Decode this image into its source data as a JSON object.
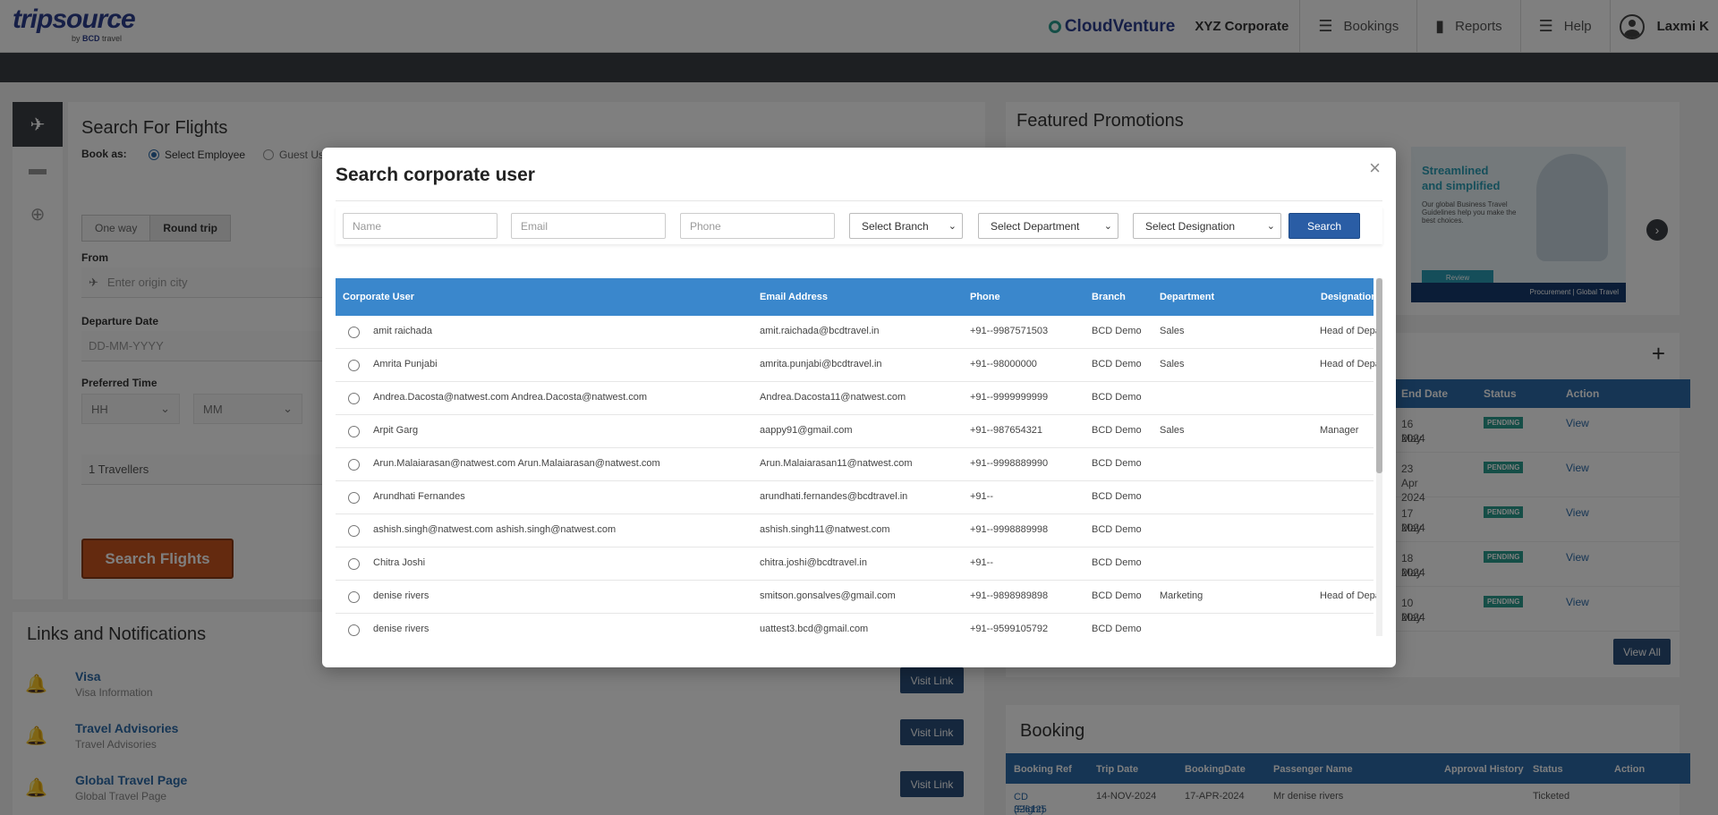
{
  "header": {
    "logo": "tripsource",
    "logo_sub_by": "by",
    "logo_sub_brand": "BCD",
    "logo_sub_travel": "travel",
    "cloudventure": "CloudVenture",
    "corporate": "XYZ Corporate",
    "nav": [
      {
        "label": "Bookings",
        "icon": "list-icon"
      },
      {
        "label": "Reports",
        "icon": "bar-chart-icon"
      },
      {
        "label": "Help",
        "icon": "list-icon"
      }
    ],
    "user": "Laxmi K"
  },
  "search": {
    "title": "Search For Flights",
    "book_as": "Book as:",
    "option_employee": "Select Employee",
    "option_guest": "Guest Us",
    "trip_oneway": "One way",
    "trip_round": "Round trip",
    "from_label": "From",
    "origin_placeholder": "Enter origin city",
    "departure_label": "Departure Date",
    "date_placeholder": "DD-MM-YYYY",
    "time_label": "Preferred Time",
    "hh": "HH",
    "mm": "MM",
    "travellers": "1 Travellers",
    "search_button": "Search Flights"
  },
  "links": {
    "title": "Links and Notifications",
    "items": [
      {
        "title": "Visa",
        "subtitle": "Visa Information",
        "button": "Visit Link"
      },
      {
        "title": "Travel Advisories",
        "subtitle": "Travel Advisories",
        "button": "Visit Link"
      },
      {
        "title": "Global Travel Page",
        "subtitle": "Global Travel Page",
        "button": "Visit Link"
      }
    ]
  },
  "promotions": {
    "title": "Featured Promotions",
    "headline_1": "Streamlined",
    "headline_2": "and simplified",
    "body": "Our global Business Travel Guidelines help you make the best choices.",
    "button": "Review",
    "footer": "Procurement | Global Travel"
  },
  "approvals": {
    "columns": [
      "End Date",
      "Status",
      "Action"
    ],
    "rows": [
      {
        "end_date_1": "16 May",
        "end_date_2": "2024",
        "status": "PENDING",
        "action": "View"
      },
      {
        "end_date_1": "23 Apr 2024",
        "end_date_2": "",
        "status": "PENDING",
        "action": "View"
      },
      {
        "end_date_1": "17 May",
        "end_date_2": "2024",
        "status": "PENDING",
        "action": "View"
      },
      {
        "end_date_1": "18 May",
        "end_date_2": "2024",
        "status": "PENDING",
        "action": "View"
      },
      {
        "end_date_1": "10 May",
        "end_date_2": "2024",
        "status": "PENDING",
        "action": "View"
      }
    ],
    "view_all": "View All"
  },
  "booking": {
    "title": "Booking",
    "columns": [
      "Booking Ref",
      "Trip Date",
      "BookingDate",
      "Passenger Name",
      "Approval History",
      "Status",
      "Action"
    ],
    "row": {
      "ref": "CD 326125",
      "ref_sub": "(Flight)",
      "trip_date": "14-NOV-2024",
      "booking_date": "17-APR-2024",
      "passenger": "Mr denise rivers",
      "status": "Ticketed"
    }
  },
  "modal": {
    "title": "Search corporate user",
    "close": "×",
    "filters": {
      "name_placeholder": "Name",
      "email_placeholder": "Email",
      "phone_placeholder": "Phone",
      "branch": "Select Branch",
      "department": "Select Department",
      "designation": "Select Designation",
      "search": "Search"
    },
    "columns": [
      "Corporate User",
      "Email Address",
      "Phone",
      "Branch",
      "Department",
      "Designation"
    ],
    "rows": [
      {
        "user": "amit raichada",
        "email": "amit.raichada@bcdtravel.in",
        "phone": "+91--9987571503",
        "branch": "BCD Demo",
        "department": "Sales",
        "designation": "Head of Department"
      },
      {
        "user": "Amrita Punjabi",
        "email": "amrita.punjabi@bcdtravel.in",
        "phone": "+91--98000000",
        "branch": "BCD Demo",
        "department": "Sales",
        "designation": "Head of Department"
      },
      {
        "user": "Andrea.Dacosta@natwest.com Andrea.Dacosta@natwest.com",
        "email": "Andrea.Dacosta11@natwest.com",
        "phone": "+91--9999999999",
        "branch": "BCD Demo",
        "department": "",
        "designation": ""
      },
      {
        "user": "Arpit Garg",
        "email": "aappy91@gmail.com",
        "phone": "+91--987654321",
        "branch": "BCD Demo",
        "department": "Sales",
        "designation": "Manager"
      },
      {
        "user": "Arun.Malaiarasan@natwest.com Arun.Malaiarasan@natwest.com",
        "email": "Arun.Malaiarasan11@natwest.com",
        "phone": "+91--9998889990",
        "branch": "BCD Demo",
        "department": "",
        "designation": ""
      },
      {
        "user": "Arundhati Fernandes",
        "email": "arundhati.fernandes@bcdtravel.in",
        "phone": "+91--",
        "branch": "BCD Demo",
        "department": "",
        "designation": ""
      },
      {
        "user": "ashish.singh@natwest.com ashish.singh@natwest.com",
        "email": "ashish.singh11@natwest.com",
        "phone": "+91--9998889998",
        "branch": "BCD Demo",
        "department": "",
        "designation": ""
      },
      {
        "user": "Chitra Joshi",
        "email": "chitra.joshi@bcdtravel.in",
        "phone": "+91--",
        "branch": "BCD Demo",
        "department": "",
        "designation": ""
      },
      {
        "user": "denise rivers",
        "email": "smitson.gonsalves@gmail.com",
        "phone": "+91--9898989898",
        "branch": "BCD Demo",
        "department": "Marketing",
        "designation": "Head of Department"
      },
      {
        "user": "denise rivers",
        "email": "uattest3.bcd@gmail.com",
        "phone": "+91--9599105792",
        "branch": "BCD Demo",
        "department": "",
        "designation": ""
      }
    ]
  },
  "colors": {
    "accent": "#3a87cc",
    "search_button": "#2a5da5",
    "orange": "#c9541f",
    "pending": "#2a9d8f"
  }
}
